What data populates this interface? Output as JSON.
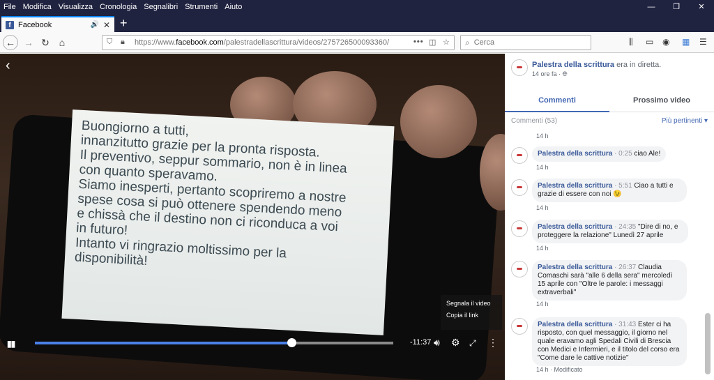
{
  "menu": [
    "File",
    "Modifica",
    "Visualizza",
    "Cronologia",
    "Segnalibri",
    "Strumenti",
    "Aiuto"
  ],
  "window_controls": [
    "—",
    "❐",
    "✕"
  ],
  "tab": {
    "favicon": "f",
    "title": "Facebook",
    "sound": "🔊",
    "close": "✕"
  },
  "new_tab": "+",
  "nav": {
    "back": "←",
    "forward": "→",
    "reload": "↻",
    "home": "⌂",
    "url_prefix": "https://www.",
    "url_domain": "facebook.com",
    "url_path": "/palestradellascrittura/videos/275726500093360/",
    "page_actions": "•••",
    "search_placeholder": "Cerca",
    "toolbar_icons": [
      "library-icon",
      "sidebar-icon",
      "account-icon",
      "extensions-icon",
      "menu-icon"
    ]
  },
  "video": {
    "note_lines": [
      "Buongiorno a tutti,",
      "innanzitutto grazie per la pronta risposta.",
      "Il preventivo, seppur sommario, non è in linea",
      "con quanto speravamo.",
      "Siamo inesperti, pertanto scopriremo a nostre",
      "spese cosa si può ottenere spendendo meno",
      "e chissà che il destino non ci riconduca a voi",
      "in futuro!",
      "Intanto vi ringrazio moltissimo per la",
      "disponibilità!"
    ],
    "context_menu": [
      "Segnala il video",
      "Copia il link"
    ],
    "time_remaining": "-11:37",
    "progress": 0.715
  },
  "panel": {
    "page_name": "Palestra della scrittura",
    "status": "era in diretta.",
    "posted": "14 ore fa · ",
    "tabs": [
      "Commenti",
      "Prossimo video"
    ],
    "comment_count": "Commenti (53)",
    "sort": "Più pertinenti ▾",
    "top_time": "14 h",
    "comments": [
      {
        "author": "Palestra della scrittura",
        "ts": "· 0:25",
        "text": " ciao Ale!",
        "meta": "14 h"
      },
      {
        "author": "Palestra della scrittura",
        "ts": "· 5:51",
        "text": " Ciao a tutti e grazie di essere con noi 😉",
        "meta": "14 h"
      },
      {
        "author": "Palestra della scrittura",
        "ts": "· 24:35",
        "text": " \"Dire di no, e proteggere la relazione\" Lunedì 27 aprile",
        "meta": "14 h"
      },
      {
        "author": "Palestra della scrittura",
        "ts": "· 26:37",
        "text": " Claudia Comaschi sarà \"alle 6 della sera\" mercoledì 15 aprile con \"Oltre le parole: i messaggi extraverbali\"",
        "meta": "14 h"
      },
      {
        "author": "Palestra della scrittura",
        "ts": "· 31:43",
        "text": " Ester ci ha risposto, con quel messaggio, il giorno nel quale eravamo agli Spedali Civili di Brescia con Medici e Infermieri, e il titolo del corso era \"Come dare le cattive notizie\"",
        "meta": "14 h · Modificato"
      }
    ]
  }
}
